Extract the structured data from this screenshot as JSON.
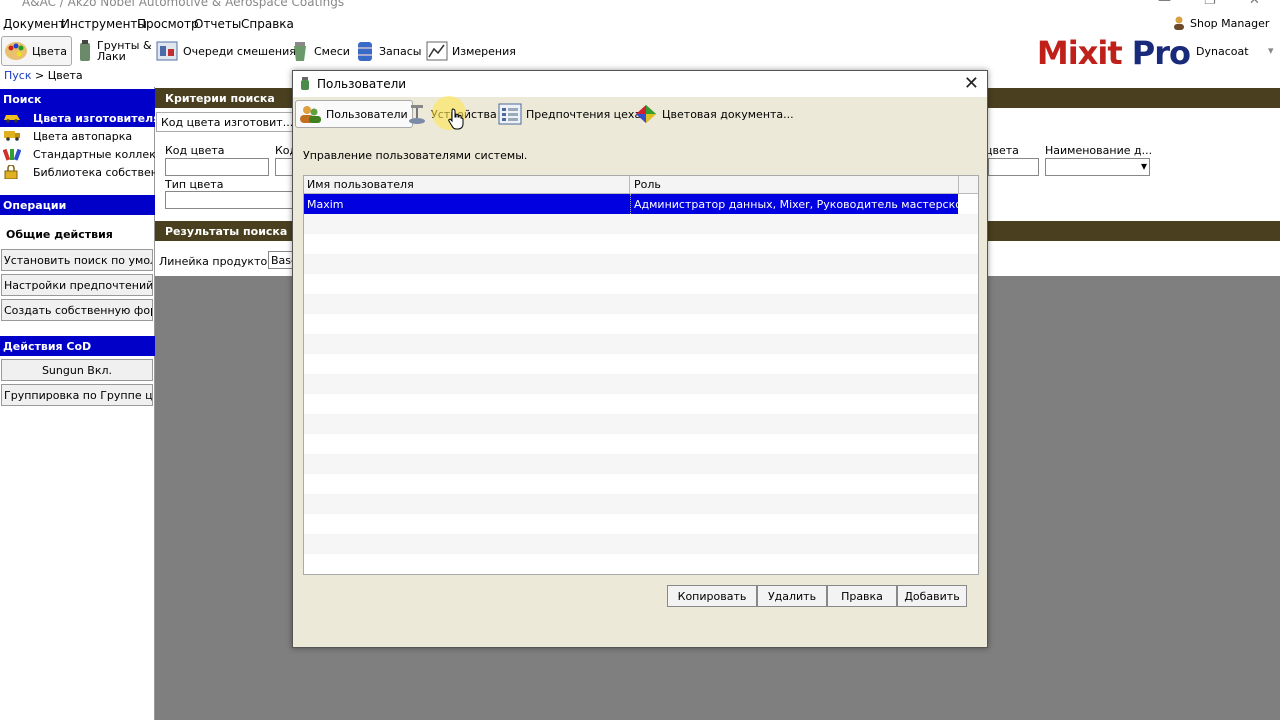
{
  "window": {
    "title": "A&AC / Akzo Nobel Automotive & Aerospace Coatings"
  },
  "menu": {
    "items": [
      "Документ",
      "Инструменты",
      "Просмотр",
      "Отчеты",
      "Справка"
    ]
  },
  "user_menu": {
    "label": "Shop Manager"
  },
  "toolbar": {
    "items": [
      {
        "label": "Цвета",
        "icon": "palette-icon"
      },
      {
        "label": "Грунты &\nЛаки",
        "icon": "primer-can-icon"
      },
      {
        "label": "Очереди смешения",
        "icon": "mixing-queue-icon"
      },
      {
        "label": "Смеси",
        "icon": "mix-jar-icon"
      },
      {
        "label": "Запасы",
        "icon": "stock-barrel-icon"
      },
      {
        "label": "Измерения",
        "icon": "chart-icon"
      }
    ]
  },
  "logo": {
    "part1": "Mixit",
    "part2": "Pro",
    "brand": "Dynacoat",
    "color_red": "#c0201a",
    "color_blue": "#1a2a7a"
  },
  "breadcrumb": {
    "root": "Пуск",
    "sep": " > ",
    "current": "Цвета"
  },
  "left": {
    "search_header": "Поиск",
    "search_items": [
      "Цвета изготовителя",
      "Цвета автопарка",
      "Стандартные коллекции",
      "Библиотека собственных"
    ],
    "ops_header": "Операции",
    "ops_label": "Общие действия",
    "ops_buttons": [
      "Установить поиск по умолчанию",
      "Настройки предпочтений продукта",
      "Создать собственную формулу"
    ],
    "cod_header": "Действия CoD",
    "cod_buttons": [
      "Sungun Вкл.",
      "Группировка по Группе цвета"
    ]
  },
  "main": {
    "criteria_header": "Критерии поиска",
    "tab_label": "Код цвета изготовит...",
    "f_code": "Код цвета",
    "f_code2": "Код",
    "f_type": "Тип цвета",
    "f_right1": "цвета",
    "f_right2": "Наименование д...",
    "results_header": "Результаты поиска",
    "product_line_label": "Линейка продуктов",
    "product_line_value": "Base"
  },
  "dialog": {
    "title": "Пользователи",
    "close": "✕",
    "tabs": [
      {
        "label": "Пользователи",
        "icon": "users-icon"
      },
      {
        "label": "Устройства",
        "icon": "scale-device-icon"
      },
      {
        "label": "Предпочтения цеха",
        "icon": "preferences-list-icon"
      },
      {
        "label": "Цветовая документа...",
        "icon": "color-doc-icon"
      }
    ],
    "description": "Управление пользователями системы.",
    "columns": [
      "Имя пользователя",
      "Роль"
    ],
    "rows": [
      {
        "name": "Maxim",
        "role": "Администратор данных, Mixer, Руководитель мастерской, У..."
      }
    ],
    "buttons": [
      "Копировать",
      "Удалить",
      "Правка",
      "Добавить"
    ]
  }
}
